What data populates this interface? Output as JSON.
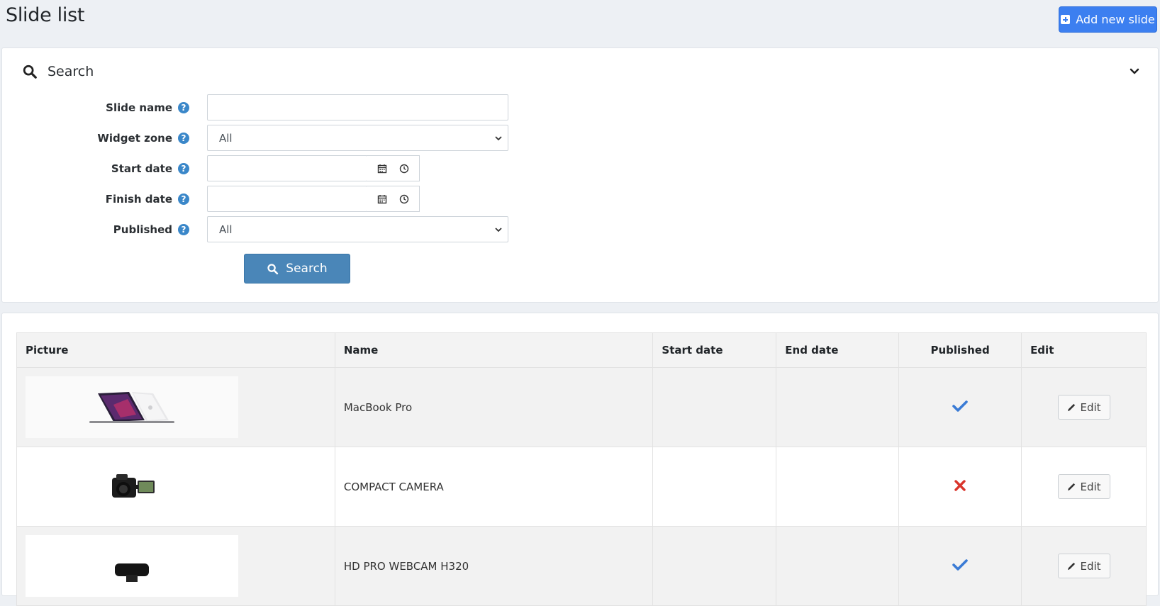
{
  "header": {
    "title": "Slide list",
    "add_button_label": "Add new slide"
  },
  "search": {
    "title": "Search",
    "fields": {
      "slide_name_label": "Slide name",
      "widget_zone_label": "Widget zone",
      "widget_zone_value": "All",
      "start_date_label": "Start date",
      "finish_date_label": "Finish date",
      "published_label": "Published",
      "published_value": "All"
    },
    "button_label": "Search"
  },
  "table": {
    "columns": [
      "Picture",
      "Name",
      "Start date",
      "End date",
      "Published",
      "Edit"
    ],
    "rows": [
      {
        "picture": "laptop-image",
        "name": "MacBook Pro",
        "start_date": "",
        "end_date": "",
        "published": true,
        "edit_label": "Edit"
      },
      {
        "picture": "camera-image",
        "name": "COMPACT CAMERA",
        "start_date": "",
        "end_date": "",
        "published": false,
        "edit_label": "Edit"
      },
      {
        "picture": "webcam-image",
        "name": "HD PRO WEBCAM H320",
        "start_date": "",
        "end_date": "",
        "published": true,
        "edit_label": "Edit"
      }
    ]
  },
  "colors": {
    "primary": "#3c7ff0",
    "search_button": "#4a86b8",
    "help_icon": "#3a87c9",
    "published_yes": "#3a7bd5",
    "published_no": "#d9342b"
  }
}
